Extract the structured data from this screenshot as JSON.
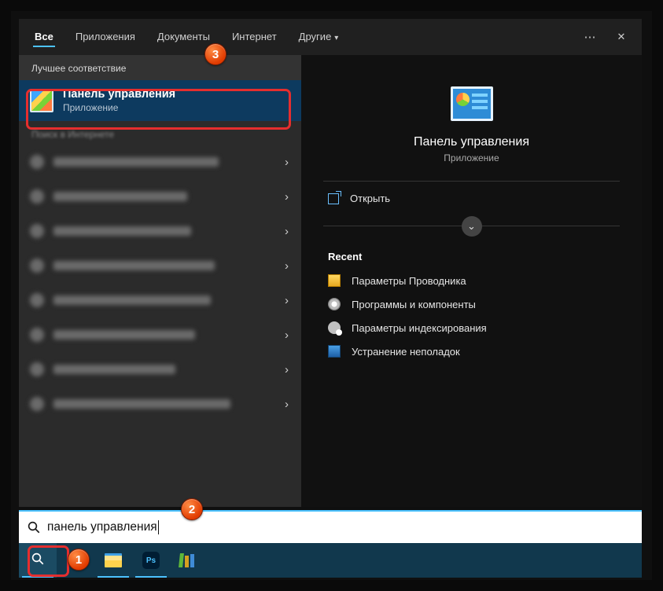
{
  "tabs": {
    "all": "Все",
    "apps": "Приложения",
    "docs": "Документы",
    "web": "Интернет",
    "more": "Другие"
  },
  "section": {
    "best_match": "Лучшее соответствие",
    "web_search": "Поиск в Интернете"
  },
  "best": {
    "title": "Панель управления",
    "sub": "Приложение"
  },
  "hero": {
    "title": "Панель управления",
    "sub": "Приложение"
  },
  "open_label": "Открыть",
  "recent_label": "Recent",
  "recent": [
    "Параметры Проводника",
    "Программы и компоненты",
    "Параметры индексирования",
    "Устранение неполадок"
  ],
  "search_value": "панель управления",
  "badges": {
    "b1": "1",
    "b2": "2",
    "b3": "3"
  },
  "ps_label": "Ps",
  "blur_widths": [
    210,
    170,
    175,
    205,
    200,
    180,
    155,
    225
  ]
}
